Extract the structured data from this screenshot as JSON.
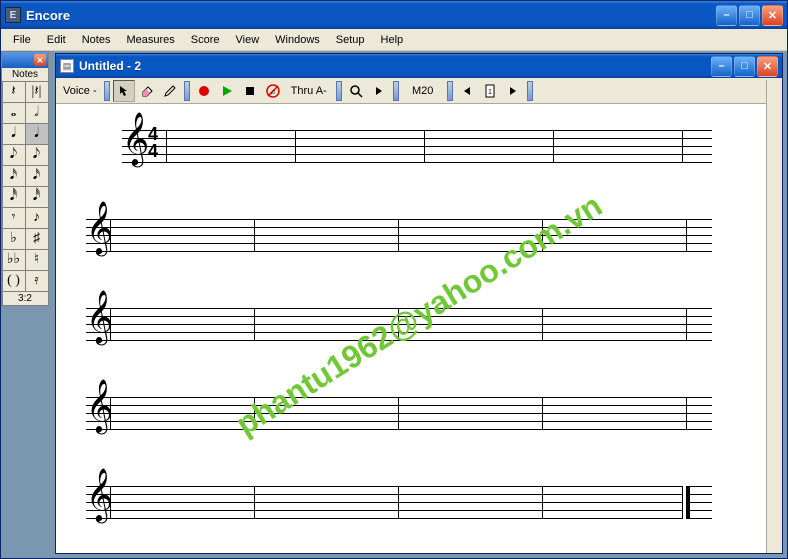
{
  "app": {
    "title": "Encore"
  },
  "menu": {
    "items": [
      "File",
      "Edit",
      "Notes",
      "Measures",
      "Score",
      "View",
      "Windows",
      "Setup",
      "Help"
    ]
  },
  "palette": {
    "title": "Notes",
    "footer": "3:2",
    "cells": [
      "𝄽",
      "|𝄽|",
      "𝅝",
      "𝅗𝅥",
      "𝅘𝅥",
      "𝅘𝅥",
      "𝅘𝅥𝅮",
      "𝅘𝅥𝅮",
      "𝅘𝅥𝅯",
      "𝅘𝅥𝅯",
      "𝅘𝅥𝅰",
      "𝅘𝅥𝅰",
      "𝄾",
      "♪",
      "♭",
      "♯",
      "♭♭",
      "♮",
      "( )",
      "𝄿"
    ]
  },
  "doc": {
    "title": "Untitled - 2"
  },
  "toolbar": {
    "voice_label": "Voice -",
    "thru_label": "Thru A-",
    "measure_label": "M20"
  },
  "score": {
    "clef": "𝄞",
    "time_num": "4",
    "time_den": "4",
    "systems": 5,
    "bars_per_system": 4
  },
  "watermark": "phantu1962@yahoo.com.vn"
}
